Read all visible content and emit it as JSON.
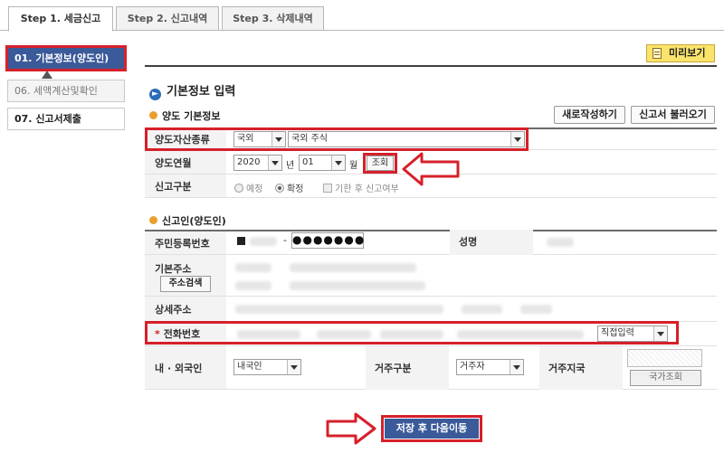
{
  "tabs": [
    "Step 1. 세금신고",
    "Step 2. 신고내역",
    "Step 3. 삭제내역"
  ],
  "sidebar": {
    "items": [
      "01. 기본정보(양도인)",
      "06. 세액계산및확인",
      "07. 신고서제출"
    ]
  },
  "header": {
    "preview_label": "미리보기",
    "section_title": "기본정보 입력",
    "section_icon": "arrow-circle-icon"
  },
  "transfer": {
    "title": "양도 기본정보",
    "new_button": "새로작성하기",
    "load_button": "신고서 불러오기",
    "asset_type_label": "양도자산종류",
    "asset_type_value1": "국외",
    "asset_type_value2": "국외 주식",
    "date_label": "양도연월",
    "year_value": "2020",
    "year_unit": "년",
    "month_value": "01",
    "month_unit": "월",
    "lookup_button": "조회",
    "report_type_label": "신고구분",
    "report_options": [
      "예정",
      "확정",
      "기한 후 신고여부"
    ]
  },
  "reporter": {
    "title": "신고인(양도인)",
    "ssn_label": "주민등록번호",
    "ssn_dash": "-",
    "ssn_masked": "●●●●●●●",
    "name_label": "성명",
    "address_label": "기본주소",
    "address_search_button": "주소검색",
    "detail_address_label": "상세주소",
    "phone_label": "전화번호",
    "phone_required_mark": "*",
    "phone_select": "직접입력",
    "nationality_label": "내 · 외국인",
    "nationality_value": "내국인",
    "residence_type_label": "거주구분",
    "residence_type_value": "거주자",
    "residence_country_label": "거주지국",
    "country_lookup_button": "국가조회"
  },
  "footer": {
    "save_button": "저장 후 다음이동"
  },
  "colors": {
    "accent": "#3b5a9a",
    "highlight": "#d6202a",
    "preview": "#fbe46b"
  }
}
